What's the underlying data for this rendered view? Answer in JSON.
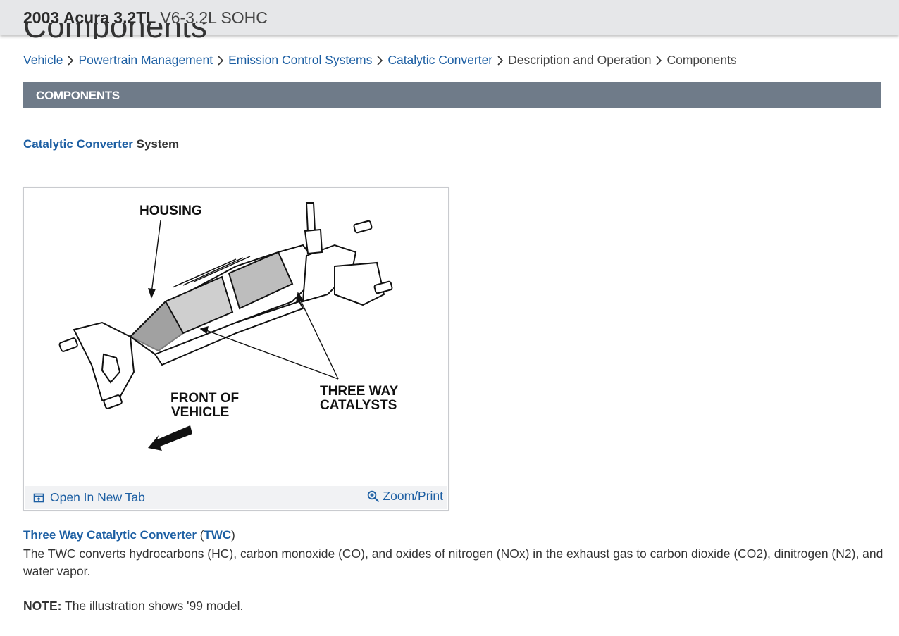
{
  "header": {
    "vehicle": "2003 Acura 3.2TL",
    "engine": "V6-3.2L SOHC",
    "page_title": "Components"
  },
  "breadcrumb": {
    "items": [
      {
        "label": "Vehicle",
        "link": true
      },
      {
        "label": "Powertrain Management",
        "link": true
      },
      {
        "label": "Emission Control Systems",
        "link": true
      },
      {
        "label": "Catalytic Converter",
        "link": true
      },
      {
        "label": "Description and Operation",
        "link": false
      },
      {
        "label": "Components",
        "link": false
      }
    ]
  },
  "section": {
    "title": "COMPONENTS"
  },
  "subheading": {
    "link_text": "Catalytic Converter",
    "suffix": "System"
  },
  "figure": {
    "labels": {
      "housing": "HOUSING",
      "front_line1": "FRONT OF",
      "front_line2": "VEHICLE",
      "twc_line1": "THREE WAY",
      "twc_line2": "CATALYSTS"
    },
    "open_tab_label": "Open In New Tab",
    "zoom_label": "Zoom/Print",
    "icons": {
      "open_tab": "open-new-tab-icon",
      "zoom": "zoom-in-icon"
    }
  },
  "twc": {
    "heading_link": "Three Way Catalytic Converter",
    "paren_open": "(",
    "abbr_link": "TWC",
    "paren_close": ")",
    "body": "The TWC converts hydrocarbons (HC), carbon monoxide (CO), and oxides of nitrogen (NOx) in the exhaust gas to carbon dioxide (CO2), dinitrogen (N2), and water vapor."
  },
  "note": {
    "label": "NOTE:",
    "text": "The illustration shows '99 model."
  },
  "colors": {
    "link": "#1d5fa3",
    "section_bar": "#6f7b89",
    "header_bg": "#e6e7e9"
  }
}
